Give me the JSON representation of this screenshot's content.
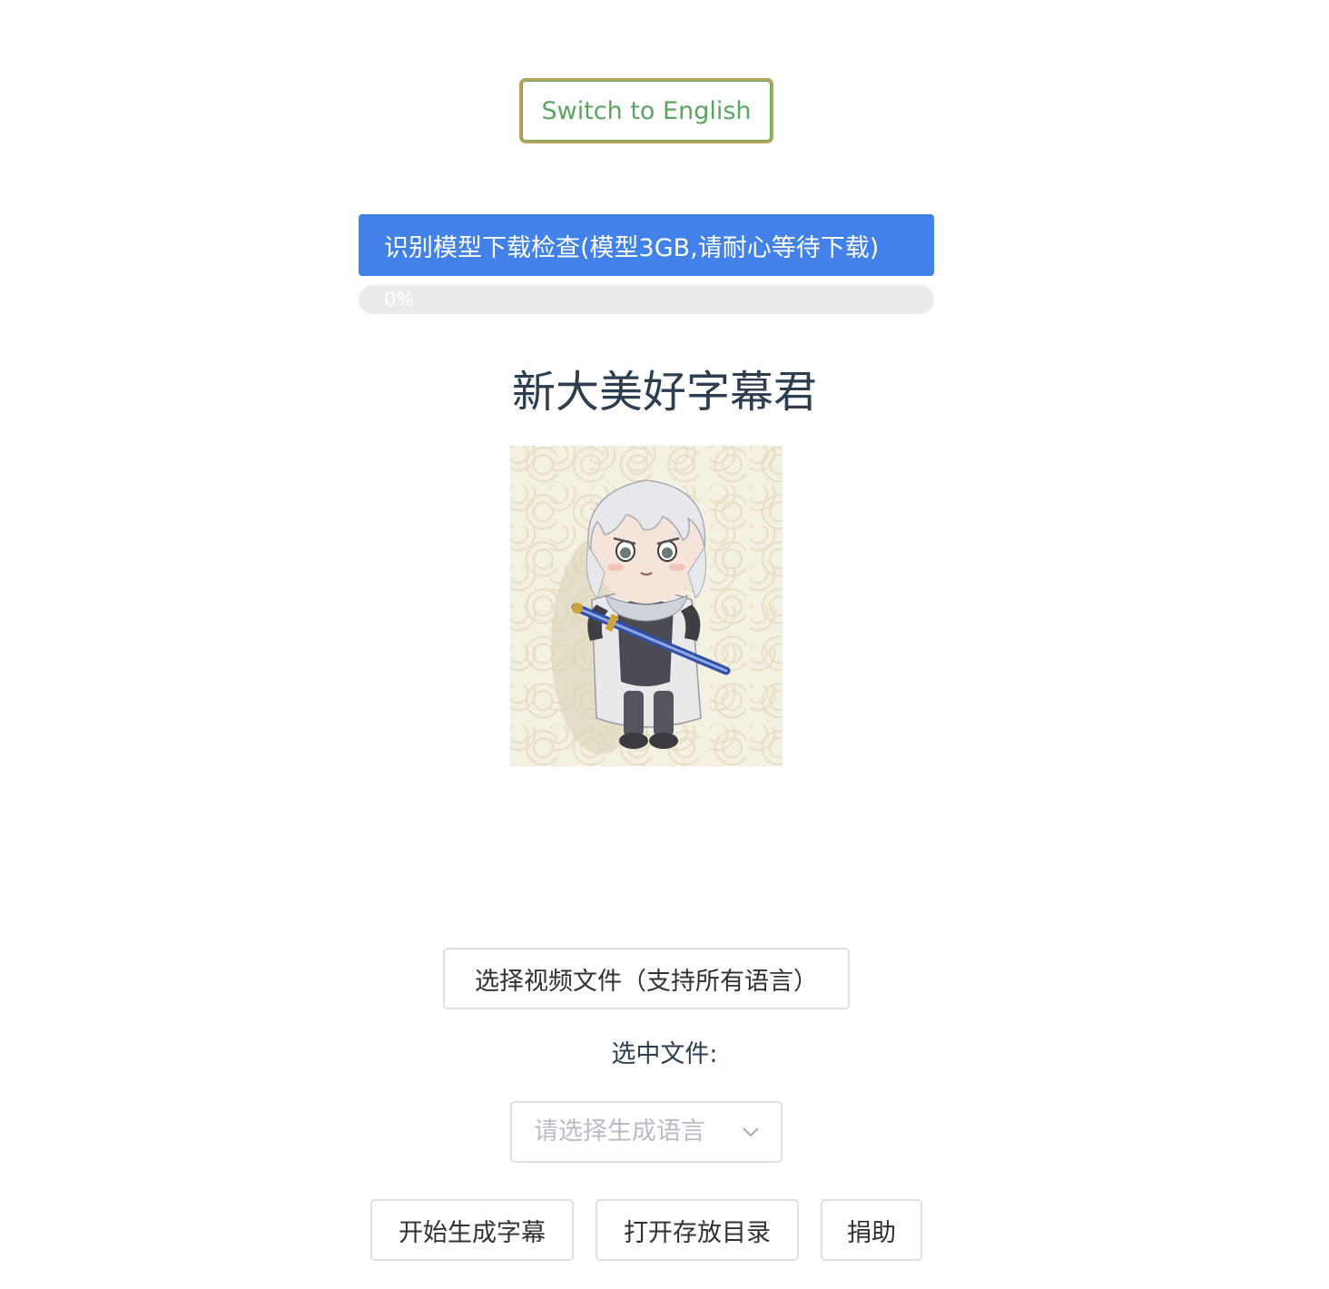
{
  "header": {
    "language_toggle_label": "Switch to English"
  },
  "model": {
    "check_label": "识别模型下载检查(模型3GB,请耐心等待下载)",
    "progress_text": "0%",
    "progress_fraction": 0
  },
  "main": {
    "title": "新大美好字幕君"
  },
  "controls": {
    "select_video_label": "选择视频文件（支持所有语言）",
    "selected_file_label": "选中文件:",
    "language_select_placeholder": "请选择生成语言",
    "start_label": "开始生成字幕",
    "open_dir_label": "打开存放目录",
    "donate_label": "捐助"
  },
  "icons": {
    "dropdown": "chevron-down-icon"
  },
  "colors": {
    "primary": "#4281e8",
    "toggle_text": "#5aa660",
    "toggle_border": "#b8a35a"
  }
}
